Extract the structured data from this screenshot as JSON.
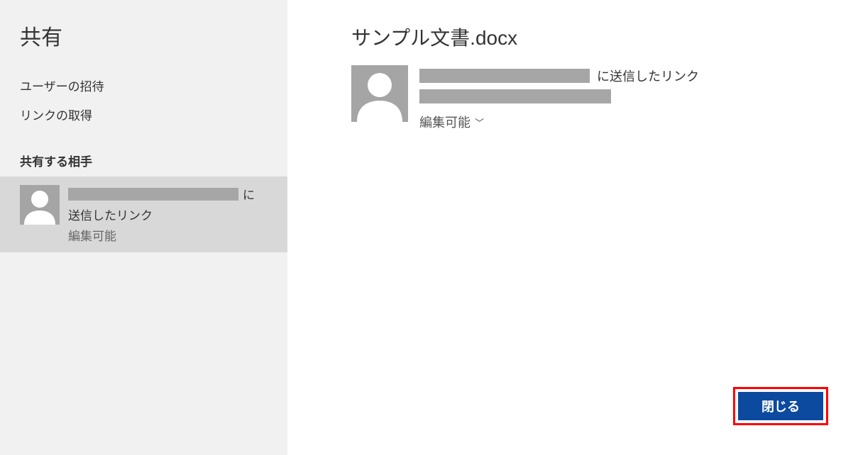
{
  "sidebar": {
    "title": "共有",
    "links": {
      "invite": "ユーザーの招待",
      "getlink": "リンクの取得"
    },
    "section": "共有する相手",
    "item": {
      "suffix": "に",
      "line2": "送信したリンク",
      "perm": "編集可能"
    }
  },
  "main": {
    "doc_title": "サンプル文書.docx",
    "suffix": "に送信したリンク",
    "perm": "編集可能",
    "close": "閉じる"
  },
  "colors": {
    "sidebar_bg": "#f1f1f1",
    "selected_bg": "#d8d8d8",
    "avatar_bg": "#a5a5a5",
    "redact_bg": "#a6a6a6",
    "button_bg": "#0b4a9e",
    "highlight_border": "#ff0000"
  }
}
